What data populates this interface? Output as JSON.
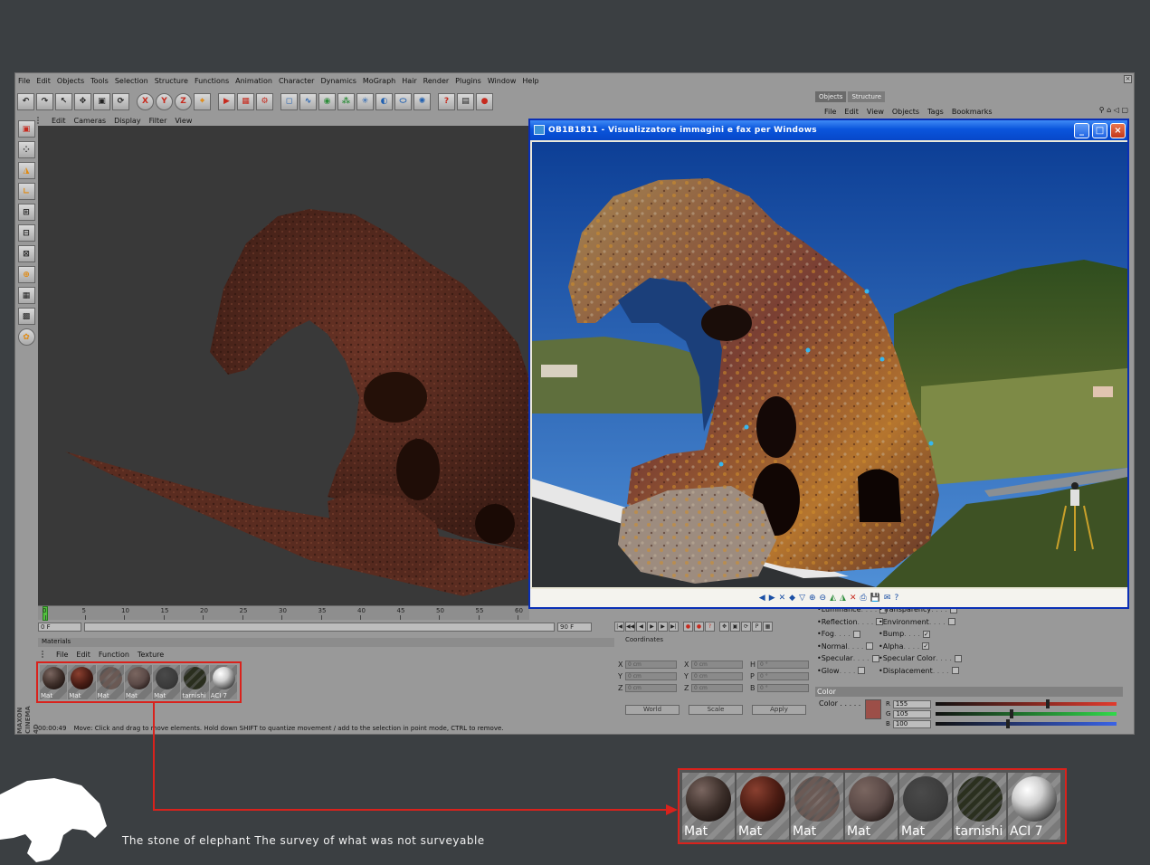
{
  "menu": [
    "File",
    "Edit",
    "Objects",
    "Tools",
    "Selection",
    "Structure",
    "Functions",
    "Animation",
    "Character",
    "Dynamics",
    "MoGraph",
    "Hair",
    "Render",
    "Plugins",
    "Window",
    "Help"
  ],
  "toolbar": [
    {
      "name": "undo-icon",
      "glyph": "↶"
    },
    {
      "name": "redo-icon",
      "glyph": "↷"
    },
    {
      "name": "live-select-icon",
      "glyph": "↖"
    },
    {
      "name": "move-icon",
      "glyph": "✥"
    },
    {
      "name": "scale-icon",
      "glyph": "▣"
    },
    {
      "name": "rotate-icon",
      "glyph": "⟳"
    },
    {
      "name": "x-axis-button",
      "glyph": "X"
    },
    {
      "name": "y-axis-button",
      "glyph": "Y"
    },
    {
      "name": "z-axis-button",
      "glyph": "Z"
    },
    {
      "name": "coordinate-system-icon",
      "glyph": "⌖"
    },
    {
      "name": "render-view-icon",
      "glyph": "▶"
    },
    {
      "name": "render-picture-icon",
      "glyph": "▦"
    },
    {
      "name": "render-settings-icon",
      "glyph": "⚙"
    },
    {
      "name": "cube-icon",
      "glyph": "◻"
    },
    {
      "name": "spline-icon",
      "glyph": "∿"
    },
    {
      "name": "nurbs-icon",
      "glyph": "◉"
    },
    {
      "name": "array-icon",
      "glyph": "⁂"
    },
    {
      "name": "deformer-icon",
      "glyph": "✳"
    },
    {
      "name": "scene-icon",
      "glyph": "◐"
    },
    {
      "name": "camera-icon",
      "glyph": "⬭"
    },
    {
      "name": "light-icon",
      "glyph": "✺"
    },
    {
      "name": "help-icon",
      "glyph": "?"
    },
    {
      "name": "layout-icon",
      "glyph": "▤"
    },
    {
      "name": "stop-icon",
      "glyph": "●"
    }
  ],
  "viewport_menu": [
    "Edit",
    "Cameras",
    "Display",
    "Filter",
    "View"
  ],
  "timeline": {
    "ticks": [
      "0",
      "5",
      "10",
      "15",
      "20",
      "25",
      "30",
      "35",
      "40",
      "45",
      "50",
      "55",
      "60"
    ],
    "start_field": "0 F",
    "end_field": "90 F"
  },
  "materials": {
    "title": "Materials",
    "menu": [
      "File",
      "Edit",
      "Function",
      "Texture"
    ],
    "items": [
      {
        "label": "Mat",
        "color": "#3e2f2a",
        "pattern": "rough"
      },
      {
        "label": "Mat",
        "color": "#4a1d15",
        "pattern": "smooth"
      },
      {
        "label": "Mat",
        "color": "#6a5954",
        "pattern": "striped"
      },
      {
        "label": "Mat",
        "color": "#5b4a47",
        "pattern": "rough"
      },
      {
        "label": "Mat",
        "color": "#3a3a3a",
        "pattern": "flat"
      },
      {
        "label": "tarnishi",
        "color": "#2a2e1e",
        "pattern": "striped"
      },
      {
        "label": "ACI 7",
        "color": "#cfcfcf",
        "pattern": "chrome"
      }
    ]
  },
  "status": {
    "time": "00:00:49",
    "message": "Move: Click and drag to move elements. Hold down SHIFT to quantize movement / add to the selection in point mode, CTRL to remove."
  },
  "coordinates": {
    "title": "Coordinates",
    "rows": [
      [
        "X",
        "0 cm",
        "X",
        "0 cm",
        "H",
        "0 °"
      ],
      [
        "Y",
        "0 cm",
        "Y",
        "0 cm",
        "P",
        "0 °"
      ],
      [
        "Z",
        "0 cm",
        "Z",
        "0 cm",
        "B",
        "0 °"
      ]
    ],
    "world": "World",
    "scale": "Scale",
    "apply": "Apply"
  },
  "objects_panel": {
    "tabs": [
      "Objects",
      "Structure"
    ],
    "menu": [
      "File",
      "Edit",
      "View",
      "Objects",
      "Tags",
      "Bookmarks"
    ],
    "icons": "⚲ ⌂ ◁ ▢"
  },
  "attributes": {
    "left": [
      {
        "label": "Luminance",
        "checked": false
      },
      {
        "label": "Reflection",
        "checked": false
      },
      {
        "label": "Fog",
        "checked": false
      },
      {
        "label": "Normal",
        "checked": false
      },
      {
        "label": "Specular",
        "checked": false
      },
      {
        "label": "Glow",
        "checked": false
      }
    ],
    "right": [
      {
        "label": "Transparency",
        "checked": false
      },
      {
        "label": "Environment",
        "checked": false
      },
      {
        "label": "Bump",
        "checked": true
      },
      {
        "label": "Alpha",
        "checked": true
      },
      {
        "label": "Specular Color",
        "checked": false
      },
      {
        "label": "Displacement",
        "checked": false
      }
    ],
    "color_section": "Color",
    "color_label": "Color . . . . .",
    "swatch": "#9c4f48",
    "rgb": [
      {
        "ch": "R",
        "value": "155",
        "grad": "linear-gradient(90deg,#111,#e23b2e)",
        "level": 0.61
      },
      {
        "ch": "G",
        "value": "105",
        "grad": "linear-gradient(90deg,#111,#31d94b)",
        "level": 0.41
      },
      {
        "ch": "B",
        "value": "100",
        "grad": "linear-gradient(90deg,#111,#3a63e6)",
        "level": 0.39
      }
    ]
  },
  "viewer": {
    "title": "OB1B1811 - Visualizzatore immagini e fax per Windows",
    "buttons": [
      {
        "g": "◀",
        "c": ""
      },
      {
        "g": "▶",
        "c": ""
      },
      {
        "g": "✕",
        "c": ""
      },
      {
        "g": "◆",
        "c": ""
      },
      {
        "g": "▽",
        "c": ""
      },
      {
        "g": "⊕",
        "c": ""
      },
      {
        "g": "⊖",
        "c": ""
      },
      {
        "g": "◭",
        "c": "g"
      },
      {
        "g": "◮",
        "c": "g"
      },
      {
        "g": "✕",
        "c": "r"
      },
      {
        "g": "⎙",
        "c": ""
      },
      {
        "g": "💾",
        "c": ""
      },
      {
        "g": "✉",
        "c": ""
      },
      {
        "g": "?",
        "c": ""
      }
    ]
  },
  "callout": {
    "items": [
      {
        "label": "Mat",
        "color": "#3b2e29",
        "pattern": "rough"
      },
      {
        "label": "Mat",
        "color": "#4b1c13",
        "pattern": "smooth"
      },
      {
        "label": "Mat",
        "color": "#6b5a55",
        "pattern": "striped"
      },
      {
        "label": "Mat",
        "color": "#5a4946",
        "pattern": "rough"
      },
      {
        "label": "Mat",
        "color": "#3b3b3b",
        "pattern": "flat"
      },
      {
        "label": "tarnishi",
        "color": "#2b301f",
        "pattern": "striped"
      },
      {
        "label": "ACI 7",
        "color": "#d0d0d0",
        "pattern": "chrome"
      }
    ]
  },
  "caption": "The stone of elephant The survey of what was not surveyable"
}
